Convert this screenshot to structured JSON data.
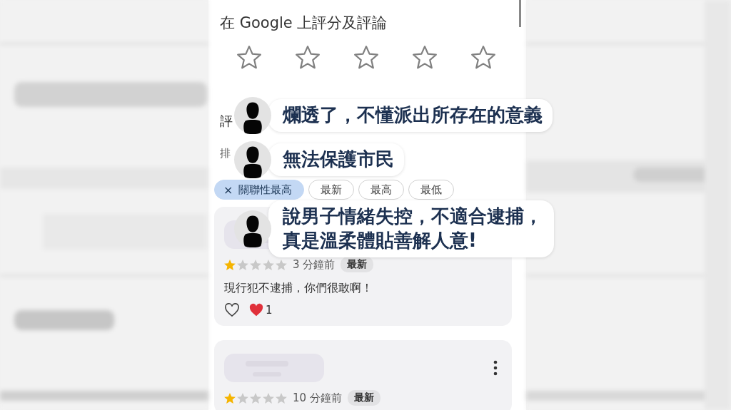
{
  "header": {
    "title": "在 Google 上評分及評論",
    "stars": 0
  },
  "section_heading": "評",
  "sort_label": "排",
  "sort_chips": [
    {
      "label": "關聯性最高",
      "selected": true,
      "close": "×"
    },
    {
      "label": "最新",
      "selected": false
    },
    {
      "label": "最高",
      "selected": false
    },
    {
      "label": "最低",
      "selected": false
    }
  ],
  "reviews": [
    {
      "stars": 1,
      "time": "3 分鐘前",
      "badge": "最新",
      "text": "現行犯不逮捕，你們很敢啊！",
      "like_count": "1"
    },
    {
      "stars": 1,
      "time": "10 分鐘前",
      "badge": "最新"
    }
  ],
  "comment_overlays": [
    {
      "text": "爛透了，不懂派出所存在的意義"
    },
    {
      "text": "無法保護市民"
    },
    {
      "text": "說男子情緒失控，不適合逮捕，真是溫柔體貼善解人意!"
    }
  ]
}
